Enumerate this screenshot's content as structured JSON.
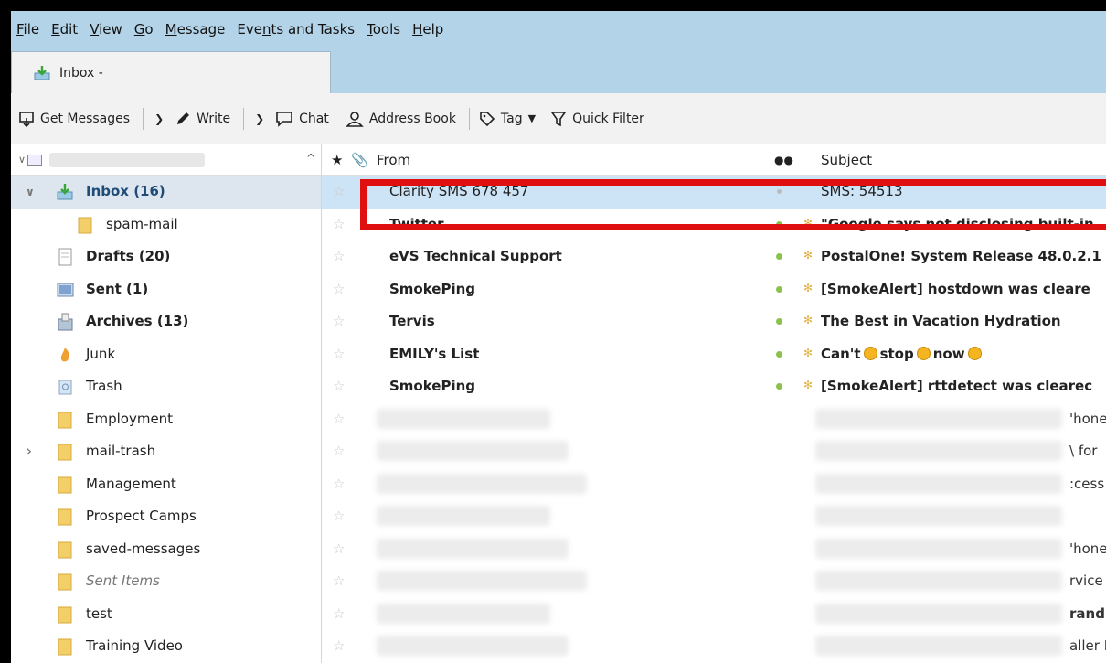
{
  "menu": {
    "items": [
      {
        "pre": "",
        "ul": "F",
        "post": "ile"
      },
      {
        "pre": "",
        "ul": "E",
        "post": "dit"
      },
      {
        "pre": "",
        "ul": "V",
        "post": "iew"
      },
      {
        "pre": "",
        "ul": "G",
        "post": "o"
      },
      {
        "pre": "",
        "ul": "M",
        "post": "essage"
      },
      {
        "pre": "Eve",
        "ul": "n",
        "post": "ts and Tasks"
      },
      {
        "pre": "",
        "ul": "T",
        "post": "ools"
      },
      {
        "pre": "",
        "ul": "H",
        "post": "elp"
      }
    ]
  },
  "tab": {
    "label": "Inbox -"
  },
  "toolbar": {
    "get_messages": "Get Messages",
    "write": "Write",
    "chat": "Chat",
    "address_book": "Address Book",
    "tag": "Tag",
    "quick_filter": "Quick Filter"
  },
  "folders": [
    {
      "label": "Inbox (16)",
      "icon": "inbox-icon",
      "indent": 1,
      "selected": true,
      "bold": true,
      "twisty": "expanded"
    },
    {
      "label": "spam-mail",
      "icon": "folder-icon",
      "indent": 2
    },
    {
      "label": "Drafts (20)",
      "icon": "drafts-icon",
      "indent": 1,
      "bold": true
    },
    {
      "label": "Sent (1)",
      "icon": "sent-icon",
      "indent": 1,
      "bold": true
    },
    {
      "label": "Archives (13)",
      "icon": "archive-icon",
      "indent": 1,
      "bold": true
    },
    {
      "label": "Junk",
      "icon": "junk-icon",
      "indent": 1
    },
    {
      "label": "Trash",
      "icon": "trash-icon",
      "indent": 1
    },
    {
      "label": "Employment",
      "icon": "folder-icon",
      "indent": 1
    },
    {
      "label": "mail-trash",
      "icon": "folder-icon",
      "indent": 1,
      "twisty": "collapsed"
    },
    {
      "label": "Management",
      "icon": "folder-icon",
      "indent": 1
    },
    {
      "label": "Prospect Camps",
      "icon": "folder-icon",
      "indent": 1
    },
    {
      "label": "saved-messages",
      "icon": "folder-icon",
      "indent": 1
    },
    {
      "label": "Sent Items",
      "icon": "folder-icon",
      "indent": 1,
      "italic": true
    },
    {
      "label": "test",
      "icon": "folder-icon",
      "indent": 1
    },
    {
      "label": "Training Video",
      "icon": "folder-icon",
      "indent": 1
    }
  ],
  "columns": {
    "from": "From",
    "subject": "Subject"
  },
  "messages": [
    {
      "from": "Clarity SMS 678      457",
      "subject": "SMS: 54513",
      "selected": true,
      "unread": false,
      "dot": "grey"
    },
    {
      "from": "Twitter",
      "subject": "\"Google says not disclosing built-in",
      "unread": true,
      "dot": "green"
    },
    {
      "from": "eVS Technical Support",
      "subject": "PostalOne! System Release 48.0.2.1",
      "unread": true,
      "dot": "green"
    },
    {
      "from": "SmokePing",
      "subject": "[SmokeAlert] hostdown was cleare",
      "unread": true,
      "dot": "green"
    },
    {
      "from": "Tervis",
      "subject": "The Best in Vacation Hydration",
      "unread": true,
      "dot": "green"
    },
    {
      "from": "EMILY's List",
      "subject": "Can't",
      "subject_words": [
        "stop",
        "now"
      ],
      "unread": true,
      "dot": "green",
      "emoji": true
    },
    {
      "from": "SmokePing",
      "subject": "[SmokeAlert] rttdetect was clearec",
      "unread": true,
      "dot": "green"
    }
  ],
  "fragments": [
    "'hone",
    "\\ for",
    ":cess",
    "",
    "'hone",
    "rvice",
    "rand",
    "aller I"
  ]
}
